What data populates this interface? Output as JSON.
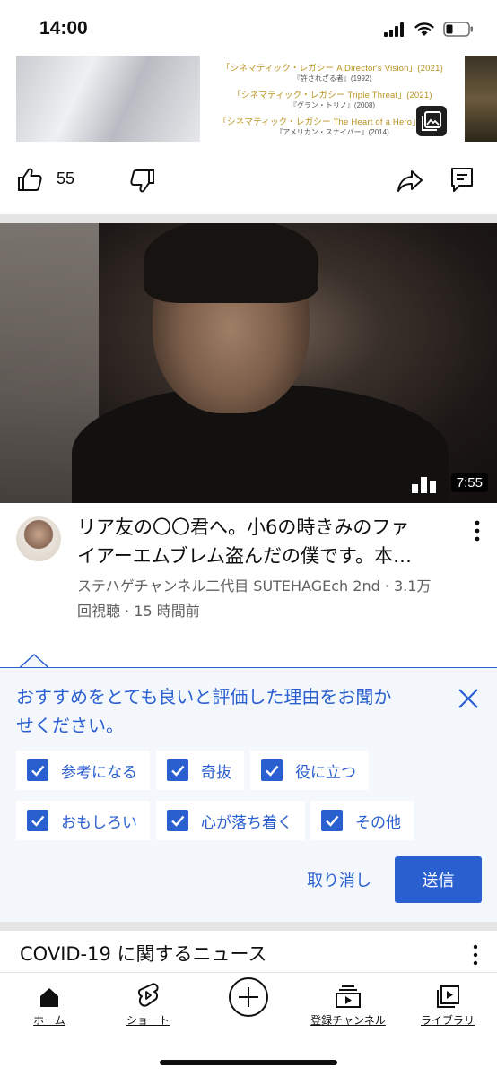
{
  "status_bar": {
    "time": "14:00"
  },
  "top_thumbnail": {
    "credits": [
      {
        "title": "「シネマティック・レガシー A Director's Vision」(2021)",
        "subtitle": "『許されざる者』(1992)"
      },
      {
        "title": "「シネマティック・レガシー Triple Threat」(2021)",
        "subtitle": "『グラン・トリノ』(2008)"
      },
      {
        "title": "「シネマティック・レガシー The Heart of a Hero」(2021)",
        "subtitle": "『アメリカン・スナイパー』(2014)"
      }
    ]
  },
  "actions": {
    "like_count": "55"
  },
  "video": {
    "duration": "7:55",
    "title_line1": "リア友の〇〇君へ。小6の時きみのファ",
    "title_line2": "イアーエムブレム盗んだの僕です。本…",
    "meta_line1": "ステハゲチャンネル二代目 SUTEHAGEch 2nd · 3.1万",
    "meta_line2": "回視聴 · 15 時間前"
  },
  "feedback": {
    "question_line1": "おすすめをとても良いと評価した理由をお聞か",
    "question_line2": "せください。",
    "options": [
      {
        "label": "参考になる",
        "checked": true
      },
      {
        "label": "奇抜",
        "checked": true
      },
      {
        "label": "役に立つ",
        "checked": true
      },
      {
        "label": "おもしろい",
        "checked": true
      },
      {
        "label": "心が落ち着く",
        "checked": true
      },
      {
        "label": "その他",
        "checked": true
      }
    ],
    "cancel_label": "取り消し",
    "submit_label": "送信",
    "accent_color": "#2a5fd0"
  },
  "section": {
    "title": "COVID-19 に関するニュース"
  },
  "bottom_nav": {
    "items": [
      {
        "label": "ホーム",
        "icon": "home-icon"
      },
      {
        "label": "ショート",
        "icon": "shorts-icon"
      },
      {
        "label": "",
        "icon": "create-icon"
      },
      {
        "label": "登録チャンネル",
        "icon": "subscriptions-icon"
      },
      {
        "label": "ライブラリ",
        "icon": "library-icon"
      }
    ]
  }
}
